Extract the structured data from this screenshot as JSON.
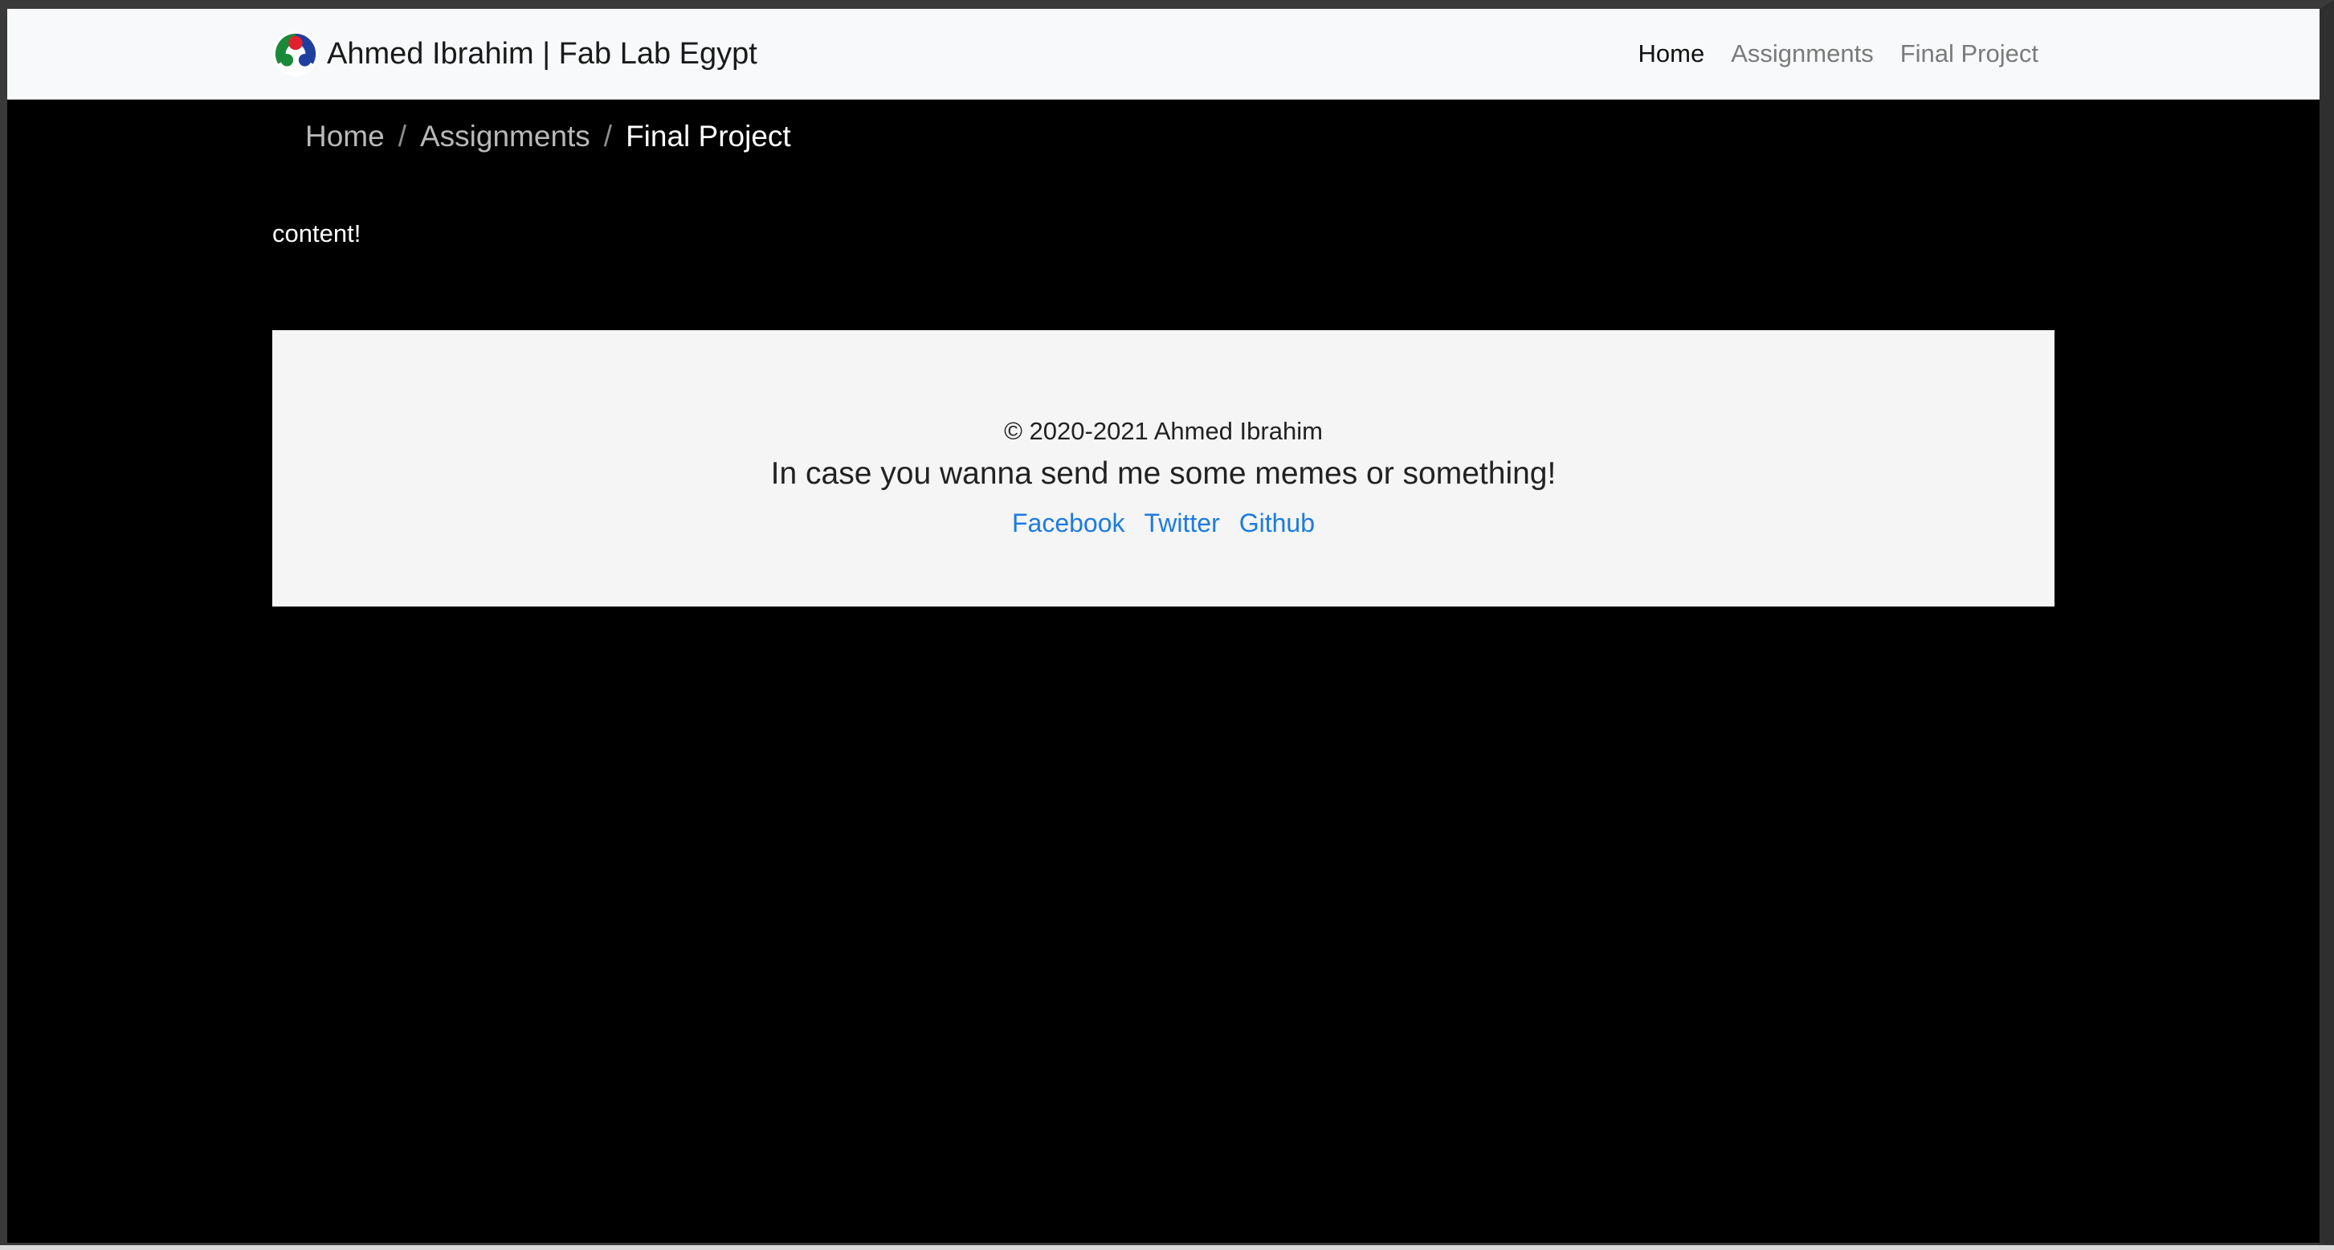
{
  "navbar": {
    "brand_text": "Ahmed Ibrahim | Fab Lab Egypt",
    "logo_icon": "fab-lab-logo",
    "links": [
      {
        "label": "Home",
        "active": true
      },
      {
        "label": "Assignments",
        "active": false
      },
      {
        "label": "Final Project",
        "active": false
      }
    ]
  },
  "breadcrumb": {
    "items": [
      "Home",
      "Assignments"
    ],
    "separator": "/",
    "current": "Final Project"
  },
  "content": {
    "text": "content!"
  },
  "footer": {
    "copyright": "© 2020-2021 Ahmed Ibrahim",
    "tagline": "In case you wanna send me some memes or something!",
    "links": [
      "Facebook",
      "Twitter",
      "Github"
    ]
  },
  "colors": {
    "page_background": "#000000",
    "navbar_background": "#f8f9fa",
    "footer_background": "#f5f5f5",
    "link": "#1c7be0"
  }
}
